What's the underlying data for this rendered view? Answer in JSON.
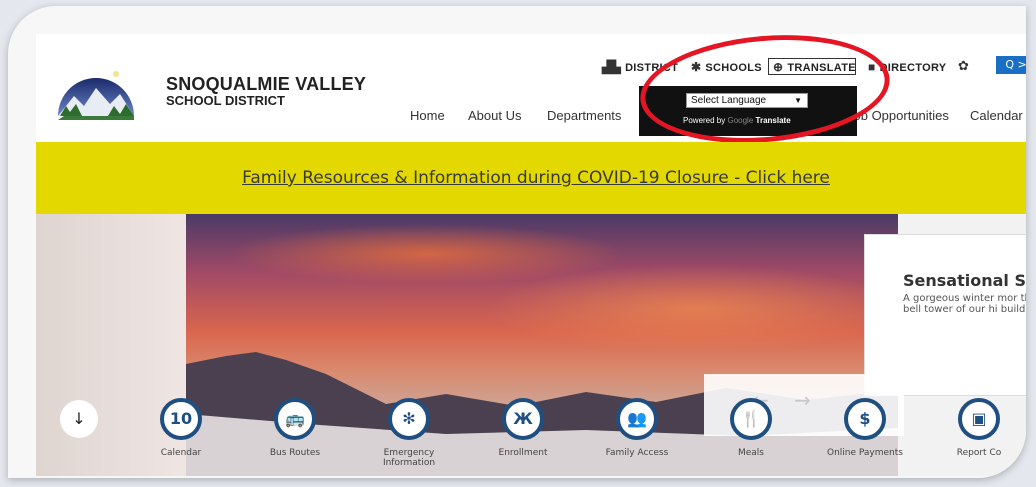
{
  "header": {
    "district_name_line1": "SNOQUALMIE VALLEY",
    "district_name_line2": "SCHOOL DISTRICT"
  },
  "utility_nav": [
    {
      "label": "DISTRICT",
      "icon": "school-building-icon"
    },
    {
      "label": "SCHOOLS",
      "icon": "graduation-cap-icon"
    },
    {
      "label": "TRANSLATE",
      "icon": "globe-icon"
    },
    {
      "label": "DIRECTORY",
      "icon": "book-icon"
    }
  ],
  "settings_icon": "gear-icon",
  "search_button": {
    "label": "Q >",
    "color": "#1a6fc4"
  },
  "main_nav": [
    {
      "label": "Home"
    },
    {
      "label": "About Us"
    },
    {
      "label": "Departments"
    },
    {
      "label": "Job Opportunities"
    },
    {
      "label": "Calendar"
    }
  ],
  "translate_popup": {
    "select_label": "Select Language",
    "powered_by": "Powered by",
    "google": "Google",
    "translate": "Translate"
  },
  "banner": {
    "text": "Family Resources & Information during COVID-19 Closure - Click here",
    "color": "#e3d800"
  },
  "hero": {
    "caption_title": "Sensational Su",
    "caption_text": "A gorgeous winter mor the bell tower of our hi building."
  },
  "quick_links": [
    {
      "label": "Calendar",
      "icon": "calendar-icon",
      "glyph": "10"
    },
    {
      "label": "Bus Routes",
      "icon": "bus-icon",
      "glyph": "🚌"
    },
    {
      "label": "Emergency Information",
      "icon": "snowflake-icon",
      "glyph": "✻"
    },
    {
      "label": "Enrollment",
      "icon": "person-icon",
      "glyph": "Ж"
    },
    {
      "label": "Family Access",
      "icon": "people-icon",
      "glyph": "👥"
    },
    {
      "label": "Meals",
      "icon": "fork-knife-icon",
      "glyph": "🍴"
    },
    {
      "label": "Online Payments",
      "icon": "dollar-icon",
      "glyph": "$"
    },
    {
      "label": "Report Co",
      "icon": "chat-icon",
      "glyph": "▣"
    }
  ],
  "highlight_color": "#e51624"
}
